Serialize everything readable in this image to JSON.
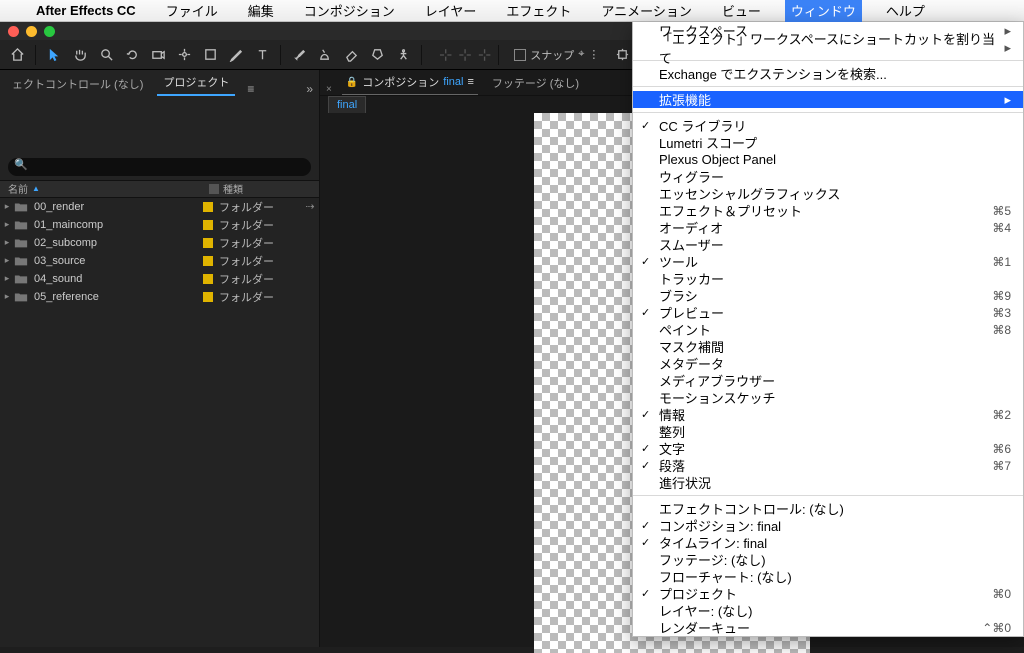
{
  "menubar": {
    "app": "After Effects CC",
    "items": [
      "ファイル",
      "編集",
      "コンポジション",
      "レイヤー",
      "エフェクト",
      "アニメーション",
      "ビュー",
      "ウィンドウ",
      "ヘルプ"
    ],
    "active_index": 7
  },
  "dropdown": {
    "groups": [
      {
        "rows": [
          {
            "label": "ワークスペース",
            "arrow": true
          },
          {
            "label": "「エフェクト」ワークスペースにショートカットを割り当て",
            "arrow": true
          }
        ]
      },
      {
        "rows": [
          {
            "label": "Exchange でエクステンションを検索..."
          }
        ]
      },
      {
        "rows": [
          {
            "label": "拡張機能",
            "arrow": true,
            "highlight": true
          }
        ]
      },
      {
        "rows": [
          {
            "label": "CC ライブラリ",
            "checked": true
          },
          {
            "label": "Lumetri スコープ"
          },
          {
            "label": "Plexus Object Panel"
          },
          {
            "label": "ウィグラー"
          },
          {
            "label": "エッセンシャルグラフィックス"
          },
          {
            "label": "エフェクト＆プリセット",
            "shortcut": "⌘5"
          },
          {
            "label": "オーディオ",
            "shortcut": "⌘4"
          },
          {
            "label": "スムーザー"
          },
          {
            "label": "ツール",
            "checked": true,
            "shortcut": "⌘1"
          },
          {
            "label": "トラッカー"
          },
          {
            "label": "ブラシ",
            "shortcut": "⌘9"
          },
          {
            "label": "プレビュー",
            "checked": true,
            "shortcut": "⌘3"
          },
          {
            "label": "ペイント",
            "shortcut": "⌘8"
          },
          {
            "label": "マスク補間"
          },
          {
            "label": "メタデータ"
          },
          {
            "label": "メディアブラウザー"
          },
          {
            "label": "モーションスケッチ"
          },
          {
            "label": "情報",
            "checked": true,
            "shortcut": "⌘2"
          },
          {
            "label": "整列"
          },
          {
            "label": "文字",
            "checked": true,
            "shortcut": "⌘6"
          },
          {
            "label": "段落",
            "checked": true,
            "shortcut": "⌘7"
          },
          {
            "label": "進行状況"
          }
        ]
      },
      {
        "rows": [
          {
            "label": "エフェクトコントロール: (なし)"
          },
          {
            "label": "コンポジション: final",
            "checked": true
          },
          {
            "label": "タイムライン: final",
            "checked": true
          },
          {
            "label": "フッテージ: (なし)"
          },
          {
            "label": "フローチャート: (なし)"
          },
          {
            "label": "プロジェクト",
            "checked": true,
            "shortcut": "⌘0"
          },
          {
            "label": "レイヤー: (なし)"
          },
          {
            "label": "レンダーキュー",
            "shortcut": "⌃⌘0"
          }
        ]
      }
    ]
  },
  "toolbar": {
    "snap_label": "スナップ"
  },
  "left_panel": {
    "tab_effectcontrol": "ェクトコントロール (なし)",
    "tab_project": "プロジェクト",
    "col_name": "名前",
    "col_type": "種類",
    "folder_type": "フォルダー",
    "items": [
      {
        "name": "00_render",
        "flow": true
      },
      {
        "name": "01_maincomp"
      },
      {
        "name": "02_subcomp"
      },
      {
        "name": "03_source"
      },
      {
        "name": "04_sound"
      },
      {
        "name": "05_reference"
      }
    ]
  },
  "center": {
    "comp_prefix": "コンポジション",
    "comp_name": "final",
    "footage_tab": "フッテージ (なし)",
    "subtab": "final"
  }
}
